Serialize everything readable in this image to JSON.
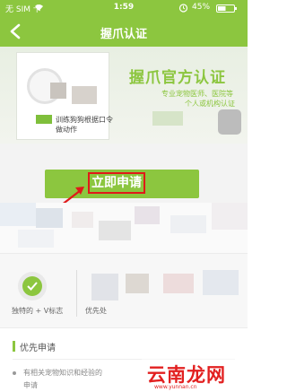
{
  "status_bar": {
    "carrier": "无 SIM 卡",
    "time": "1:59",
    "battery_percent": "45%"
  },
  "nav": {
    "title": "握爪认证"
  },
  "banner": {
    "cert_title": "握爪官方认证",
    "subtitle_line1": "专业宠物医师、医院等",
    "subtitle_line2": "个人或机构认证",
    "card_caption_line1": "训练狗狗根据口令",
    "card_caption_line2": "做动作"
  },
  "apply": {
    "button_label": "立即申请"
  },
  "benefits": {
    "item1_label": "独特的 + V标志",
    "item2_label": "优先处"
  },
  "priority": {
    "heading": "优先申请",
    "desc_line1": "有相关宠物知识和经验的",
    "desc_line2": "申请"
  },
  "watermark": {
    "text": "云南龙网",
    "url": "www.yunnan.cn"
  },
  "colors": {
    "brand_green": "#8cc63f",
    "highlight_red": "#e01919"
  }
}
